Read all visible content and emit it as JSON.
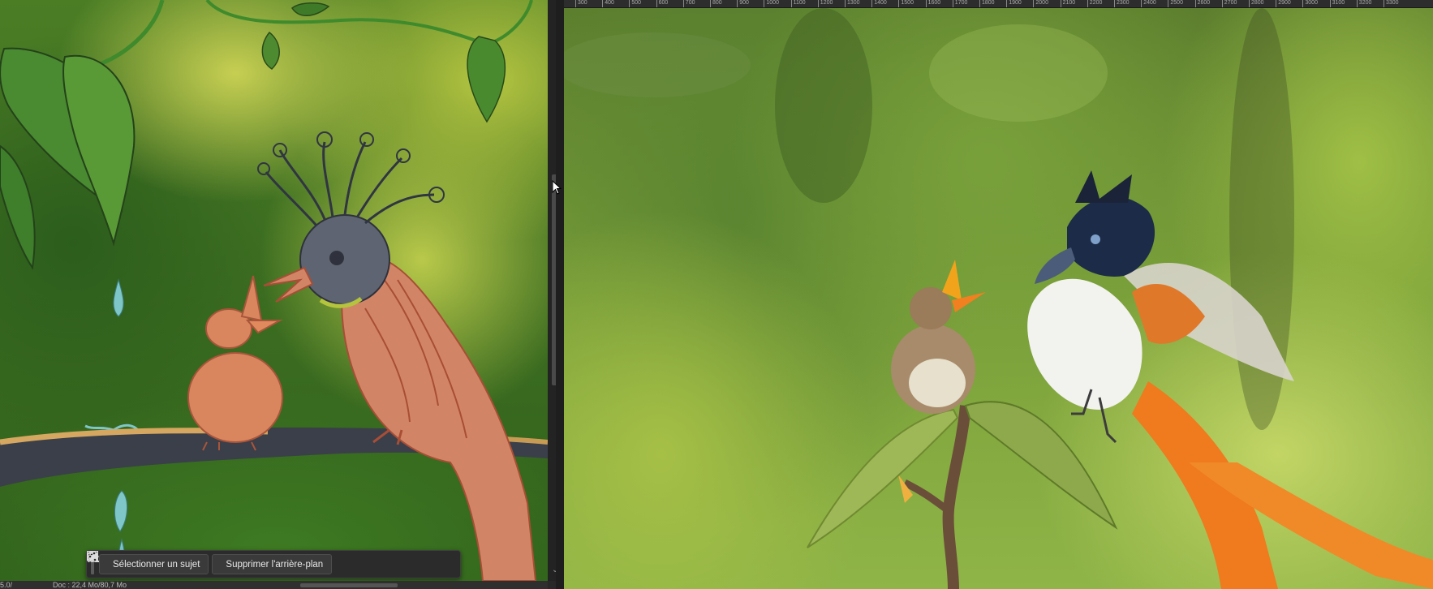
{
  "taskbar": {
    "select_subject_label": "Sélectionner un sujet",
    "remove_background_label": "Supprimer l'arrière-plan"
  },
  "statusbar": {
    "zoom": "5.0/",
    "doc_info": "Doc : 22,4 Mo/80,7 Mo"
  },
  "ruler": {
    "labels": [
      "300",
      "400",
      "500",
      "600",
      "700",
      "800",
      "900",
      "1000",
      "1100",
      "1200",
      "1300",
      "1400",
      "1500",
      "1600",
      "1700",
      "1800",
      "1900",
      "2000",
      "2100",
      "2200",
      "2300",
      "2400",
      "2500",
      "2600",
      "2700",
      "2800",
      "2900",
      "3000",
      "3100",
      "3200",
      "3300"
    ]
  },
  "icons": {
    "select_subject": "person-select-icon",
    "remove_background": "image-icon",
    "transform": "transform-icon",
    "adjust": "contrast-icon",
    "more": "ellipsis-icon",
    "settings": "sliders-icon"
  },
  "colors": {
    "app_background": "#282828",
    "taskbar_background": "#2b2b2b",
    "button_background": "#3a3a3a",
    "text": "#e8e8e8"
  }
}
